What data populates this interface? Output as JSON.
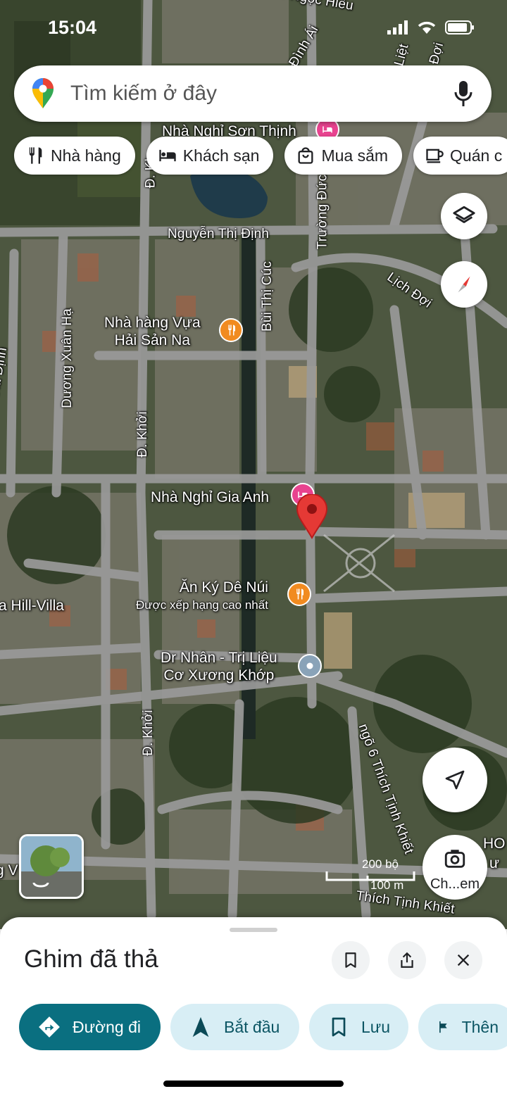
{
  "status_bar": {
    "time": "15:04"
  },
  "search": {
    "placeholder": "Tìm kiếm ở đây"
  },
  "chips": [
    {
      "label": "Nhà hàng",
      "icon": "fork-knife-icon"
    },
    {
      "label": "Khách sạn",
      "icon": "bed-icon"
    },
    {
      "label": "Mua sắm",
      "icon": "shopping-bag-icon"
    },
    {
      "label": "Quán c",
      "icon": "coffee-cup-icon"
    }
  ],
  "map": {
    "roads": [
      "Nguyễn Thị Định",
      "Bùi Thị Cúc",
      "Trường Đức",
      "Lịch Đợi",
      "Dương Xuân Hạ",
      "Gia Định",
      "Đ. Khởi",
      "Đ. Khởi",
      "Đ. Kh",
      "ngõ 6 Thích Tịnh Khiết",
      "Thích Tịnh Khiết",
      "Lê Ngọc Hiếu",
      "Đình Ái",
      "h Liệt",
      "Đợi"
    ],
    "pois": {
      "hotel_top": "Nhà Nghỉ Sơn Thịnh",
      "restaurant1_line1": "Nhà hàng Vựa",
      "restaurant1_line2": "Hải Sản Na",
      "hotel_gia_anh": "Nhà Nghỉ Gia Anh",
      "restaurant2": "Ăn Ký Dê Núi",
      "restaurant2_badge": "Được xếp hạng cao nhất",
      "clinic_line1": "Dr Nhân - Trị Liệu",
      "clinic_line2": "Cơ Xương Khớp",
      "villa": "a Hill-Villa",
      "edge_left": "g V",
      "edge_right_1": "HO",
      "edge_right_2": "ư"
    },
    "scale": {
      "top": "200 bộ",
      "bottom": "100 m"
    },
    "camera_label": "Ch...em",
    "colors": {
      "hotel_pin": "#e8438f",
      "restaurant_pin": "#f18b20",
      "dropped_pin": "#e53935",
      "clinic_pin": "#8aa3b8"
    }
  },
  "sheet": {
    "title": "Ghim đã thả",
    "actions": [
      {
        "label": "Đường đi",
        "icon": "directions-icon"
      },
      {
        "label": "Bắt đầu",
        "icon": "navigation-arrow-icon"
      },
      {
        "label": "Lưu",
        "icon": "bookmark-icon"
      },
      {
        "label": "Thên",
        "icon": "flag-icon"
      }
    ],
    "accent": "#0a6f80"
  }
}
